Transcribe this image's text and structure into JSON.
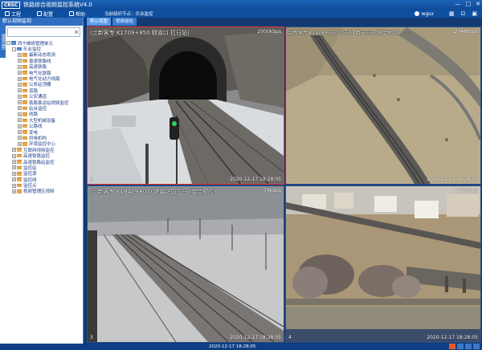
{
  "app": {
    "logo": "CRSC",
    "title": "铁路综合视频监控系统V4.0",
    "window_buttons": [
      "—",
      "□",
      "✕"
    ]
  },
  "menu": {
    "items": [
      "工程",
      "配置",
      "帮助"
    ],
    "org_label": "当前组织节点：乐业监控",
    "user": "wgsx",
    "tools": [
      "▦",
      "⊡",
      "▣"
    ]
  },
  "left_panel": {
    "title": "默认视频监视",
    "side_tab": "视频监控",
    "search_placeholder": "",
    "tree": [
      {
        "label": "西宁维修管理单元",
        "level": 0,
        "expander": "-",
        "root": true
      },
      {
        "label": "乐业监控",
        "level": 1,
        "expander": "-",
        "root": true
      },
      {
        "label": "最新动态观测",
        "level": 2,
        "expander": "+"
      },
      {
        "label": "普速铁路线",
        "level": 2,
        "expander": "+"
      },
      {
        "label": "高速铁路",
        "level": 2,
        "expander": "+"
      },
      {
        "label": "电气化铁路",
        "level": 2,
        "expander": "+"
      },
      {
        "label": "电气化动力线路",
        "level": 2,
        "expander": "+"
      },
      {
        "label": "公务站顶棚",
        "level": 2,
        "expander": "+"
      },
      {
        "label": "道路",
        "level": 2,
        "expander": "+"
      },
      {
        "label": "公安通道",
        "level": 2,
        "expander": "+"
      },
      {
        "label": "铁路客运站视频监控",
        "level": 2,
        "expander": "+"
      },
      {
        "label": "站台监控",
        "level": 2,
        "expander": "+"
      },
      {
        "label": "线路",
        "level": 2,
        "expander": "+"
      },
      {
        "label": "大型机械设备",
        "level": 2,
        "expander": "+"
      },
      {
        "label": "公路线",
        "level": 2,
        "expander": "+"
      },
      {
        "label": "变电",
        "level": 2,
        "expander": "+"
      },
      {
        "label": "供电机构",
        "level": 2,
        "expander": "+"
      },
      {
        "label": "环境监控中心",
        "level": 2,
        "expander": "+"
      },
      {
        "label": "互联网视频监控",
        "level": 1,
        "expander": "+"
      },
      {
        "label": "高速铁路监控",
        "level": 1,
        "expander": "+"
      },
      {
        "label": "高速铁路站监控",
        "level": 1,
        "expander": "+"
      },
      {
        "label": "监控站",
        "level": 1,
        "expander": "+"
      },
      {
        "label": "监控源",
        "level": 1,
        "expander": "+"
      },
      {
        "label": "监控线",
        "level": 1,
        "expander": "+"
      },
      {
        "label": "监控点",
        "level": 1,
        "expander": "+"
      },
      {
        "label": "视频管理区视频",
        "level": 1,
        "expander": "+"
      }
    ]
  },
  "video": {
    "tabs": [
      "默认视图",
      "视频巡检"
    ],
    "cells": [
      {
        "osd": "(兰新客专 K1709+850  隧道口 拉日站)",
        "rate": "2000kbps",
        "timestamp": "2020-12-17 18:28:05",
        "num": "1"
      },
      {
        "osd": "兰新客专 K1908+550 贝吉科 西宁方向 [固定机位]",
        "rate": "2048kbps",
        "timestamp": "2020-12-17 18:28:05",
        "num": "2"
      },
      {
        "osd": "(兰新客专 K1942+800) 铁路站向拉日 (定点机位)",
        "rate": "74kbps",
        "timestamp": "2020-12-17 18:28:05",
        "num": "3"
      },
      {
        "osd": "",
        "rate": "1765kbps",
        "timestamp": "2020-12-17 18:28:05",
        "num": "4"
      }
    ]
  },
  "status": {
    "clock": "2020-12-17  18:28:05"
  }
}
